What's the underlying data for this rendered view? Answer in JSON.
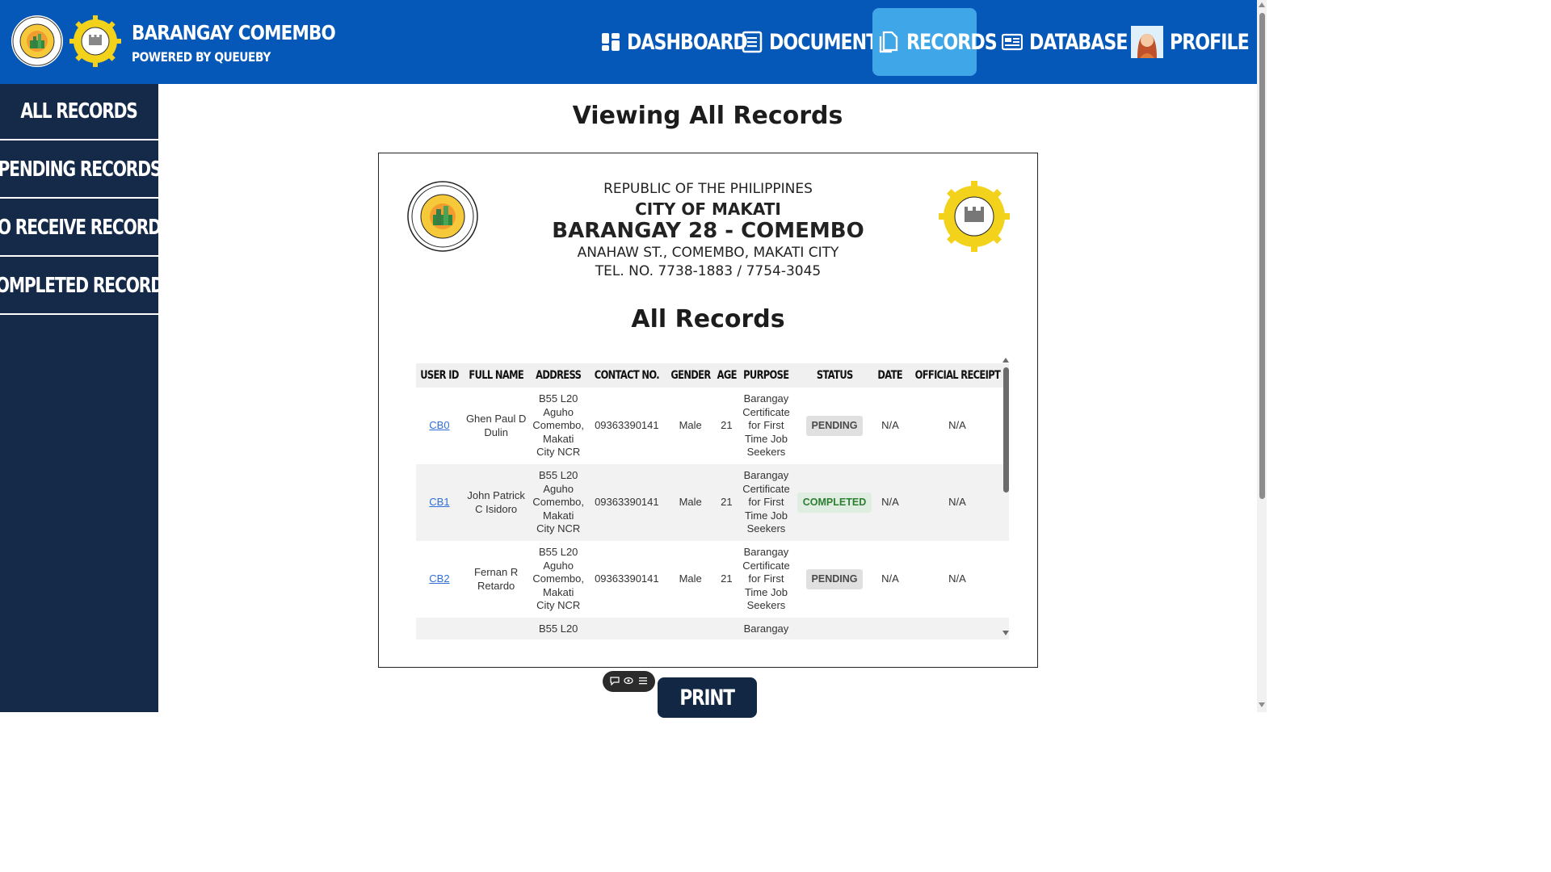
{
  "colors": {
    "header_bg": "#0658b8",
    "active_nav": "#3fa6e8",
    "sidebar_bg": "#152a48",
    "print_button": "#122744"
  },
  "brand": {
    "title": "BARANGAY COMEMBO",
    "subtitle": "POWERED BY QUEUEBY",
    "logo_left_text": "LUNGSOD NG MAKATI",
    "logo_right_text": "COMEMBO"
  },
  "nav": [
    {
      "label": "DASHBOARD",
      "icon": "dashboard-icon"
    },
    {
      "label": "DOCUMENT",
      "icon": "document-icon"
    },
    {
      "label": "RECORDS",
      "icon": "records-icon",
      "active": true
    },
    {
      "label": "DATABASE",
      "icon": "database-icon"
    },
    {
      "label": "PROFILE",
      "icon": "avatar"
    }
  ],
  "sidebar": {
    "items": [
      {
        "label": "ALL RECORDS"
      },
      {
        "label": "PENDING RECORDS"
      },
      {
        "label": "TO RECEIVE RECORDS"
      },
      {
        "label": "COMPLETED RECORDS"
      }
    ]
  },
  "page": {
    "title": "Viewing All Records"
  },
  "document": {
    "line1": "REPUBLIC OF THE PHILIPPINES",
    "line2": "CITY OF MAKATI",
    "line3": "BARANGAY 28 - COMEMBO",
    "line4": "ANAHAW ST., COMEMBO, MAKATI CITY",
    "line5": "TEL. NO. 7738-1883 / 7754-3045",
    "subtitle": "All Records"
  },
  "table": {
    "headers": [
      "USER ID",
      "FULL NAME",
      "ADDRESS",
      "CONTACT NO.",
      "GENDER",
      "AGE",
      "PURPOSE",
      "STATUS",
      "DATE",
      "OFFICIAL RECEIPT"
    ],
    "rows": [
      {
        "id": "CB0",
        "name": "Ghen Paul D Dulin",
        "address": "B55 L20 Aguho Comembo, Makati City NCR",
        "contact": "09363390141",
        "gender": "Male",
        "age": "21",
        "purpose": "Barangay Certificate for First Time Job Seekers",
        "status": "PENDING",
        "date": "N/A",
        "receipt": "N/A"
      },
      {
        "id": "CB1",
        "name": "John Patrick C Isidoro",
        "address": "B55 L20 Aguho Comembo, Makati City NCR",
        "contact": "09363390141",
        "gender": "Male",
        "age": "21",
        "purpose": "Barangay Certificate for First Time Job Seekers",
        "status": "COMPLETED",
        "date": "N/A",
        "receipt": "N/A"
      },
      {
        "id": "CB2",
        "name": "Fernan R Retardo",
        "address": "B55 L20 Aguho Comembo, Makati City NCR",
        "contact": "09363390141",
        "gender": "Male",
        "age": "21",
        "purpose": "Barangay Certificate for First Time Job Seekers",
        "status": "PENDING",
        "date": "N/A",
        "receipt": "N/A"
      },
      {
        "id": "",
        "name": "",
        "address": "B55 L20",
        "contact": "",
        "gender": "",
        "age": "",
        "purpose": "Barangay",
        "status": "",
        "date": "",
        "receipt": ""
      }
    ]
  },
  "print": {
    "label": "PRINT"
  }
}
